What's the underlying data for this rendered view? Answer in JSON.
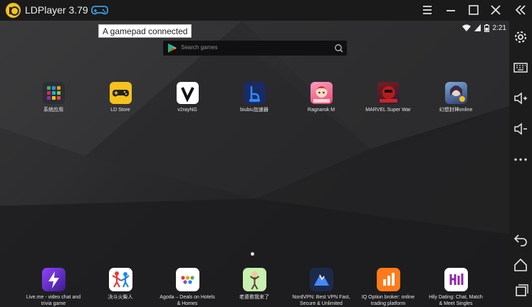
{
  "window": {
    "title": "LDPlayer 3.79",
    "tooltip": "A gamepad connected"
  },
  "status_bar": {
    "time": "2:21"
  },
  "search": {
    "placeholder": "Search games"
  },
  "home_apps": [
    {
      "label": "系统应用"
    },
    {
      "label": "LD Store"
    },
    {
      "label": "v2rayNG"
    },
    {
      "label": "biubiu加速器"
    },
    {
      "label": "Ragnarok M"
    },
    {
      "label": "MARVEL Super War"
    },
    {
      "label": "幻想封神online"
    }
  ],
  "dock_apps": [
    {
      "label_lines": [
        "Live.me - video chat and",
        "trivia game"
      ]
    },
    {
      "label_lines": [
        "决斗火柴人",
        ""
      ]
    },
    {
      "label_lines": [
        "Agoda – Deals on Hotels",
        "& Homes"
      ]
    },
    {
      "label_lines": [
        "老婆救我来了",
        ""
      ]
    },
    {
      "label_lines": [
        "NordVPN: Best VPN Fast,",
        "Secure & Unlimited"
      ]
    },
    {
      "label_lines": [
        "IQ Option broker: online",
        "trading platform"
      ]
    },
    {
      "label_lines": [
        "Hily Dating: Chat, Match",
        "& Meet Singles"
      ]
    }
  ],
  "colors": {
    "ld_yellow": "#f5c21b",
    "gamepad_blue": "#3aa0e8"
  }
}
